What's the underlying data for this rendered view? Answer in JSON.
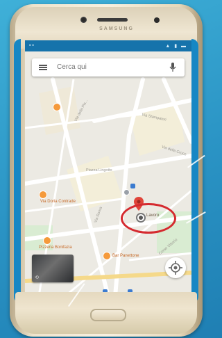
{
  "device": {
    "brand": "SAMSUNG"
  },
  "search": {
    "placeholder": "Cerca qui"
  },
  "map": {
    "streets": [
      "Via della Pis...",
      "Via Stampatori",
      "Via della Croce",
      "Piazza Lingotto",
      "Via Roma",
      "Corso Vittorio"
    ],
    "places": [
      "Via Doria Contrade",
      "Pizzeria Bonifazia",
      "Bar Panettone"
    ],
    "pinned_location": "Lavoro"
  },
  "colors": {
    "highlight_ring": "#d52a2f",
    "poi": "#f59a3b",
    "screen_edge": "#1787c4"
  }
}
